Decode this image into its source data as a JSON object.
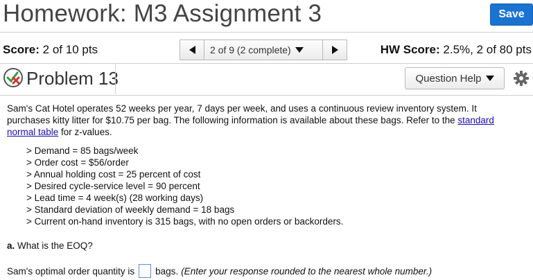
{
  "header": {
    "title": "Homework: M3 Assignment 3",
    "save_label": "Save"
  },
  "score": {
    "label": "Score:",
    "value": "2 of 10 pts"
  },
  "pager": {
    "text": "2 of 9 (2 complete)"
  },
  "hw_score": {
    "label": "HW Score:",
    "value": "2.5%, 2 of 80 pts"
  },
  "problem": {
    "title": "Problem 13",
    "help_label": "Question Help"
  },
  "question": {
    "intro_1": "Sam's Cat Hotel operates 52 weeks per year, 7 days per week, and uses a continuous review inventory system. It purchases kitty litter for $10.75 per bag. The following information is available about these bags. Refer to the",
    "link_text": "standard normal table",
    "intro_2": " for z-values.",
    "items": [
      "> Demand = 85 bags/week",
      "> Order cost = $56/order",
      "> Annual holding cost = 25 percent of cost",
      "> Desired cycle-service level = 90 percent",
      "> Lead time = 4 week(s) (28 working days)",
      "> Standard deviation of weekly demand = 18 bags",
      "> Current on-hand inventory is 315 bags, with no open orders or backorders."
    ],
    "part_a_label": "a.",
    "part_a_text": " What is the EOQ?",
    "answer_prefix": "Sam's optimal order quantity is",
    "answer_suffix": "bags.",
    "answer_hint": "(Enter your response rounded to the nearest whole number.)",
    "answer_value": ""
  },
  "colors": {
    "save_button": "#1a73d0",
    "link": "#1a0dab",
    "incorrect_mark": "#d9302c",
    "correct_mark": "#2e9e3e"
  }
}
